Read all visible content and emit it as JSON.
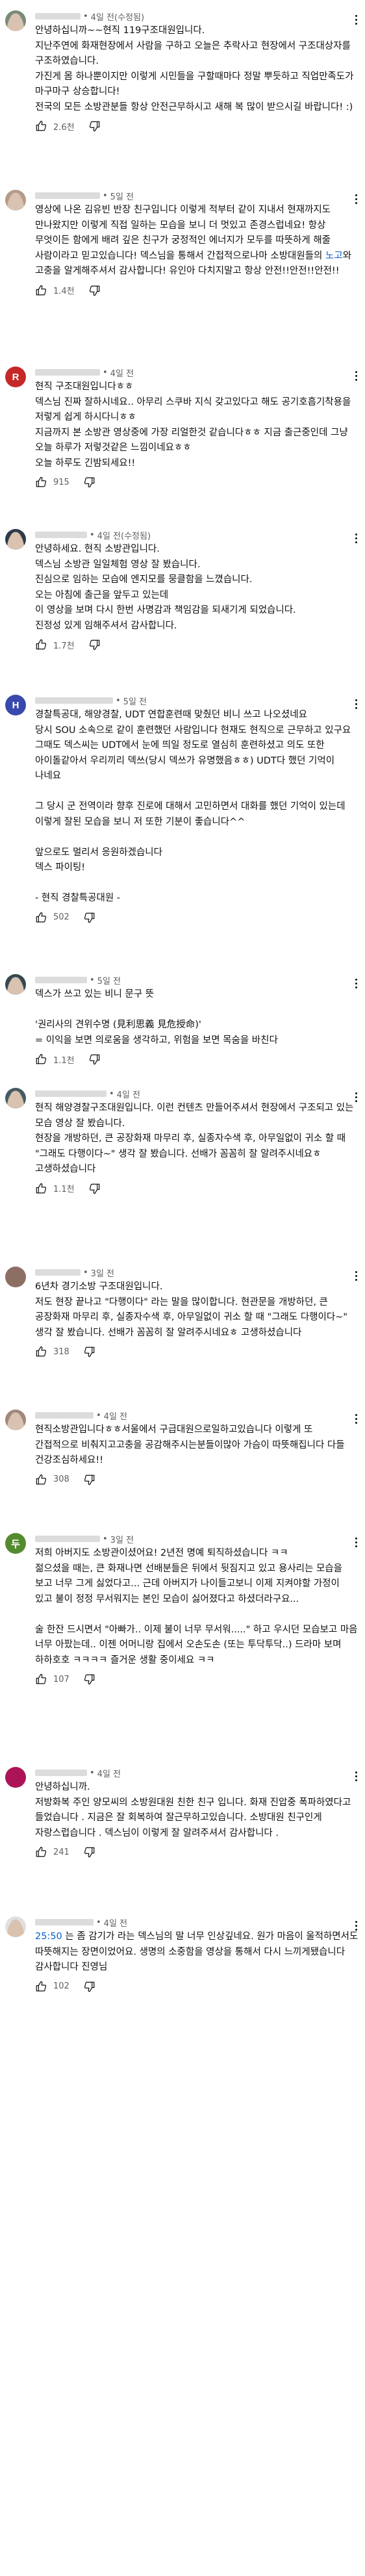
{
  "colors": {
    "link": "#065fd4",
    "meta": "#606060",
    "text": "#0f0f0f",
    "avatar_1": "#d84315",
    "avatar_3": "#c62828",
    "avatar_5": "#3949ab",
    "avatar_9": "#8d6e63",
    "avatar_11": "#6a1b9a",
    "avatar_12": "#558b2f",
    "avatar_13": "#ad1457"
  },
  "comments": [
    {
      "avatar_letter": "",
      "avatar_icon": "profile-photo",
      "time": "4일 전(수정됨)",
      "text": "안녕하십니까~~현직 119구조대원입니다.\n지난주연에 화재현장에서 사람을 구하고 오늘은 추락사고 현장에서 구조대상자를 구조하였습니다.\n가진게 몸 하나뿐이지만 이렇게 시민들을 구할때마다 정말 뿌듯하고 직업만족도가 마구마구 상승합니다!\n전국의 모든 소방관분들 항상 안전근무하시고 새해 복 많이 받으시길 바랍니다! :)",
      "likes": "2.6천"
    },
    {
      "avatar_letter": "",
      "avatar_icon": "profile-photo",
      "time": "5일 전",
      "text_parts": [
        "영상에 나온 김유빈 반장 친구입니다 이렇게 적부터 같이 지내서 현재까지도 만나왔지만 이렇게 직접 일하는 모습을 보니 더 멋있고 존경스럽네요! 항상 무엇이든 함에게 배려 깊은 친구가 궁정적인 에너지가 모두를 따뜻하게 해줄 사람이라고 믿고있습니다! 덱스님을 통해서 간접적으로나마 소방대원들의 ",
        "노고",
        "와 고충을 알게해주셔서 감사합니다! 유인아 다치지말고 항상 안전!!안전!!안전!!"
      ],
      "likes": "1.4천"
    },
    {
      "avatar_letter": "R",
      "avatar_icon": "",
      "time": "4일 전",
      "text": "현직 구조대원입니다ㅎㅎ\n덱스님 진짜 잘하시네요.. 아무리 스쿠바 지식 갖고있다고 해도 공기호흡기착용을 저렇게 쉽게 하시다니ㅎㅎ\n지금까지 본 소방관 영상중에 가장 리얼한것 같습니다ㅎㅎ 지금 출근중인데 그냥 오늘 하루가 저렇것같은 느낌이네요ㅎㅎ\n오늘 하루도 긴밤되세요!!",
      "likes": "915"
    },
    {
      "avatar_letter": "",
      "avatar_icon": "profile-photo",
      "time": "4일 전(수정됨)",
      "text": "안녕하세요. 현직 소방관입니다.\n덱스님 소방관 일일체험 영상 잘 봤습니다.\n진심으로 임하는 모습에 엔지모를 뭉클함을 느꼈습니다.\n오는 아침에 출근을 앞두고 있는데\n이 영상을 보며 다시 한번 사명감과 책임감을 되새기게 되었습니다.\n진정성 있게 임해주셔서 감사합니다.",
      "likes": "1.7천"
    },
    {
      "avatar_letter": "H",
      "avatar_icon": "",
      "time": "5일 전",
      "text": "경찰특공대, 해양경찰, UDT 연합훈련때 맞췄던 비니 쓰고 나오셨네요\n당시 SOU 소속으로 같이 훈련했던 사람입니다 현재도 현직으로 근무하고 있구요\n그때도 덱스씨는 UDT에서 눈에 띄일 정도로 열심히 훈련하셨고 의도 또한 아이돌같아서 우리끼리 덱쓰(당시 덱쓰가 유명했음ㅎㅎ) UDT다 했던 기억이 나네요\n\n그 당시 군 전역이라 향후 진로에 대해서 고민하면서 대화를 했던 기억이 있는데\n이렇게 잘된 모습을 보니 저 또한 기분이 좋습니다^^\n\n앞으로도 멀리서 응원하겠습니다\n덱스 파이팅!\n\n- 현직 경찰특공대원 -",
      "likes": "502"
    },
    {
      "avatar_letter": "",
      "avatar_icon": "profile-photo",
      "time": "5일 전",
      "text": "덱스가 쓰고 있는 비니 문구 뜻\n\n'권리사의 견위수명 (見利思義 見危授命)'\n= 이익을 보면 의로움을 생각하고, 위험을 보면 목숨을 바친다",
      "likes": "1.1천"
    },
    {
      "avatar_letter": "",
      "avatar_icon": "profile-photo",
      "time": "4일 전",
      "text": "현직 해양경찰구조대원입니다. 이런 컨텐츠 만들어주셔서 현장에서 구조되고 있는 모습 영상 잘 봤습니다.\n현장을 개방하던, 큰 공장화재 마무리 후, 실종자수색 후, 아무일없이 귀소 할 때 \"그래도 다행이다~\" 생각 잘 봤습니다. 선배가 꼼꼼히 잘 알려주시네요ㅎ 고생하셨습니다",
      "likes": "1.1천"
    },
    {
      "avatar_letter": "",
      "avatar_icon": "profile-photo",
      "time": "3일 전",
      "text": "6년차 경기소방 구조대원입니다.\n저도 현장 끝나고 \"다행이다\" 라는 말을 많이합니다. 현관문을 개방하던, 큰 공장화재 마무리 후, 실종자수색 후, 아무일없이 귀소 할 때 \"그래도 다행이다~\" 생각 잘 봤습니다. 선배가 꼼꼼히 잘 알려주시네요ㅎ 고생하셨습니다",
      "likes": "318"
    },
    {
      "avatar_letter": "",
      "avatar_icon": "profile-photo",
      "time": "4일 전",
      "text": "현직소방관입니다ㅎㅎ서울에서 구급대원으로일하고있습니다 이렇게 또 간접적으로 비춰지고고충을 공감해주시는분들이많아 가슴이 따뜻해집니다 다들 건강조심하세요!!",
      "likes": "308"
    },
    {
      "avatar_letter": "두",
      "avatar_icon": "",
      "time": "3일 전",
      "text": "저희 아버지도 소방관이셨어요! 2년전 명예 퇴직하셨습니다 ㅋㅋ\n젊으셨을 때는, 큰 화재나면 선배분들은 뒤에서 뒷짐지고 있고 용사리는 모습을 보고 너무 그게 싫었다고... 근데 아버지가 나이들고보니 이제 지켜야할 가정이 있고 불이 정정 무서워지는 본인 모습이 싫어졌다고 하셨더라구요...\n\n술 한잔 드시면서 \"아빠가.. 이제 불이 너무 무서워.....\" 하고 우시던 모습보고 마음 너무 아팠는데.. 이젠 어머니랑 집에서 오손도손 (또는 투닥투닥..) 드라마 보며 하하호호 ㅋㅋㅋㅋ 즐거운 생활 중이세요 ㅋㅋ",
      "likes": "107"
    },
    {
      "avatar_letter": "",
      "avatar_icon": "profile-photo",
      "time": "4일 전",
      "text": "안녕하십니까.\n저방화복 주인 양모씨의 소방원대원 친한 친구 입니다. 화재 진압중 폭파하였다고 들었습니다 . 지금은 잘 회복하여 잘근무하고있습니다. 소방대원 친구인게 자랑스럽습니다 . 덱스님이 이렇게 잘 알려주셔서 감사합니다 .",
      "likes": "241"
    },
    {
      "avatar_letter": "",
      "avatar_icon": "profile-photo",
      "time": "4일 전",
      "ts": "25:50",
      "text": " 는 좀 감기가 라는 덱스님의 말 너무 인상깊네요. 원가 마음이 울적하면서도 따뜻해지는 장면이었어요. 생명의 소중함을 영상을 통해서 다시 느끼게됐습니다 감사합니다 진영님",
      "likes": "102"
    }
  ]
}
